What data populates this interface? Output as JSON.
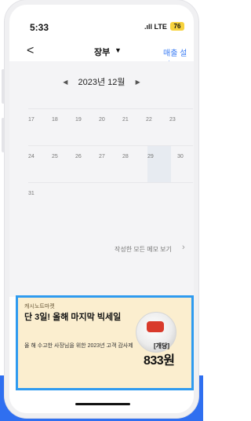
{
  "status": {
    "time": "5:33",
    "network": "LTE",
    "battery": "76"
  },
  "nav": {
    "back": "<",
    "title": "장부",
    "right": "매출 설정"
  },
  "calendar": {
    "month_label": "2023년 12월",
    "weeks": [
      [
        "17",
        "18",
        "19",
        "20",
        "21",
        "22",
        "23"
      ],
      [
        "24",
        "25",
        "26",
        "27",
        "28",
        "29",
        "30"
      ],
      [
        "31",
        "",
        "",
        "",
        "",
        "",
        ""
      ]
    ],
    "selected_day": "29"
  },
  "memo": {
    "label": "작성한 모든 메모 보기"
  },
  "ad": {
    "brand": "캐시노트마켓",
    "title": "단 3일! 올해 마지막 빅세일",
    "subtitle": "올 해 수고한 사장님을 위한 2023년 고객 감사제",
    "tag": "[개당]",
    "price": "833원"
  }
}
